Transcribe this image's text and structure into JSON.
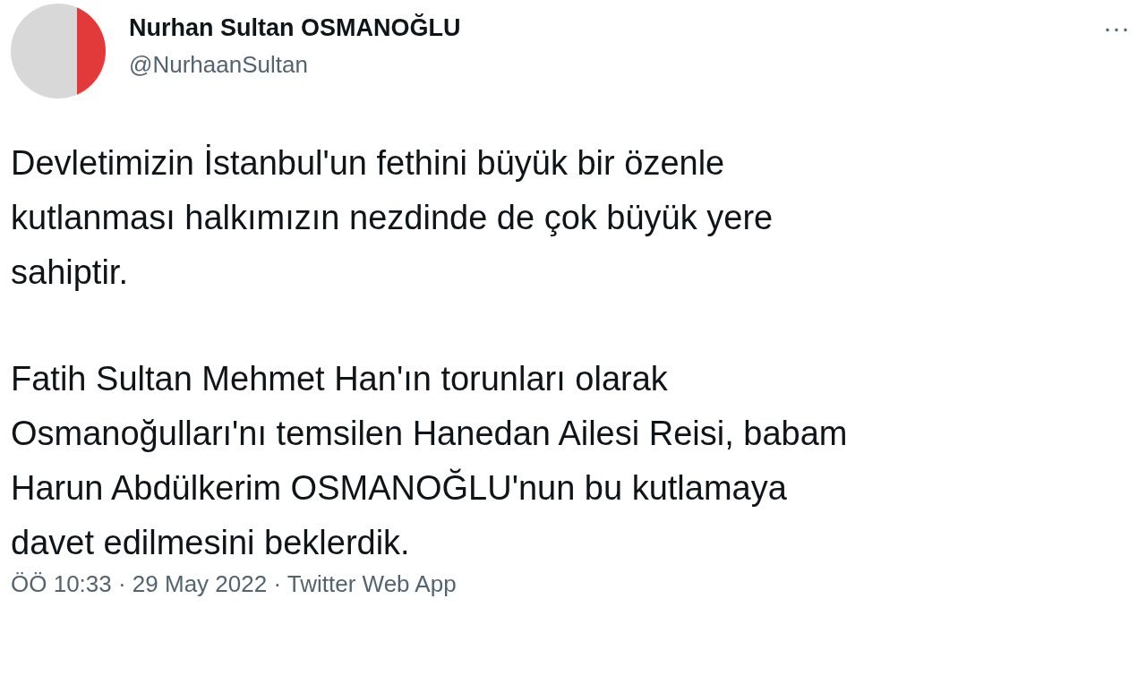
{
  "author": {
    "name": "Nurhan Sultan OSMANOĞLU",
    "handle": "@NurhaanSultan"
  },
  "menu": {
    "label": "···"
  },
  "paragraphs": [
    "Devletimizin İstanbul'un fethini büyük bir özenle\nkutlanması halkımızın nezdinde de çok büyük yere\nsahiptir.",
    "Fatih Sultan Mehmet Han'ın torunları olarak\nOsmanoğulları'nı temsilen Hanedan Ailesi Reisi, babam\nHarun Abdülkerim OSMANOĞLU'nun bu kutlamaya\ndavet edilmesini beklerdik."
  ],
  "meta": "ÖÖ 10:33 · 29 May 2022 · Twitter Web App"
}
